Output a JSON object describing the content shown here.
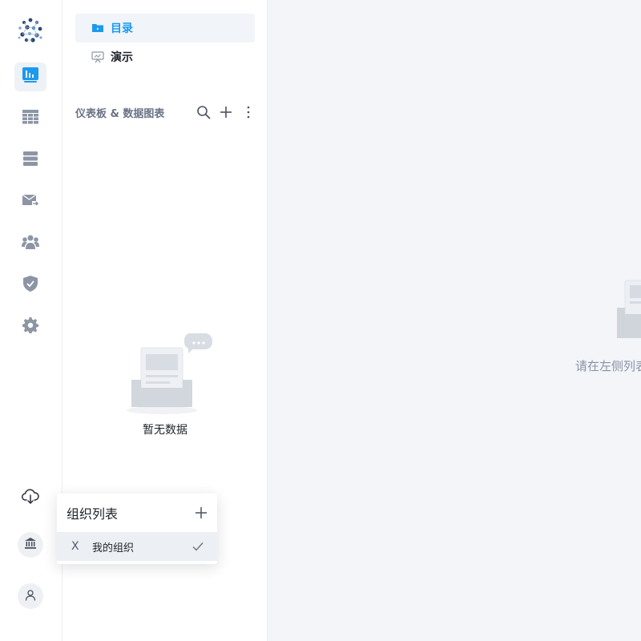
{
  "panel": {
    "nav": [
      {
        "label": "目录",
        "icon": "folder-icon",
        "active": true
      },
      {
        "label": "演示",
        "icon": "presentation-icon",
        "active": false
      }
    ],
    "section_title": "仪表板 & 数据图表",
    "empty_text": "暂无数据"
  },
  "rail": {
    "items": [
      {
        "icon": "dashboard-chart-icon",
        "active": true
      },
      {
        "icon": "table-grid-icon",
        "active": false
      },
      {
        "icon": "database-stack-icon",
        "active": false
      },
      {
        "icon": "mail-forward-icon",
        "active": false
      },
      {
        "icon": "team-users-icon",
        "active": false
      },
      {
        "icon": "shield-check-icon",
        "active": false
      },
      {
        "icon": "gear-icon",
        "active": false
      }
    ],
    "bottom": [
      "cloud-download-icon",
      "bank-icon",
      "user-icon"
    ]
  },
  "main": {
    "hint": "请在左侧列表"
  },
  "org_popover": {
    "title": "组织列表",
    "items": [
      {
        "avatar": "X",
        "name": "我的组织",
        "selected": true
      }
    ]
  },
  "colors": {
    "accent": "#1b9aee",
    "icon_gray": "#8d95a5",
    "main_bg": "#f3f5f9"
  }
}
